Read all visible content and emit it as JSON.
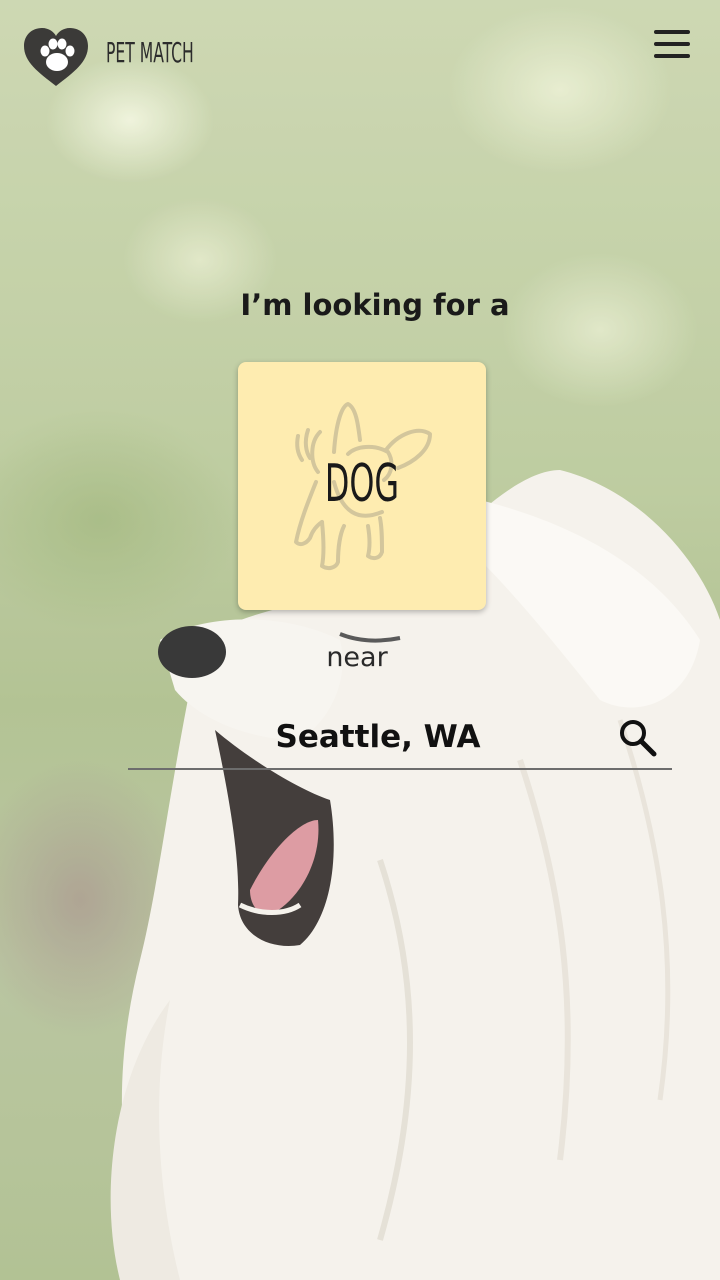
{
  "header": {
    "brand_name": "PET MATCH"
  },
  "main": {
    "prompt": "I’m looking for a",
    "pet_type": "DOG",
    "near_label": "near",
    "location_value": "Seattle, WA"
  },
  "icons": {
    "logo": "heart-paw-icon",
    "menu": "hamburger-menu-icon",
    "search": "search-icon",
    "pet": "dog-outline-icon"
  },
  "colors": {
    "card_background": "#feecb0",
    "text_primary": "#1a1a1a"
  }
}
